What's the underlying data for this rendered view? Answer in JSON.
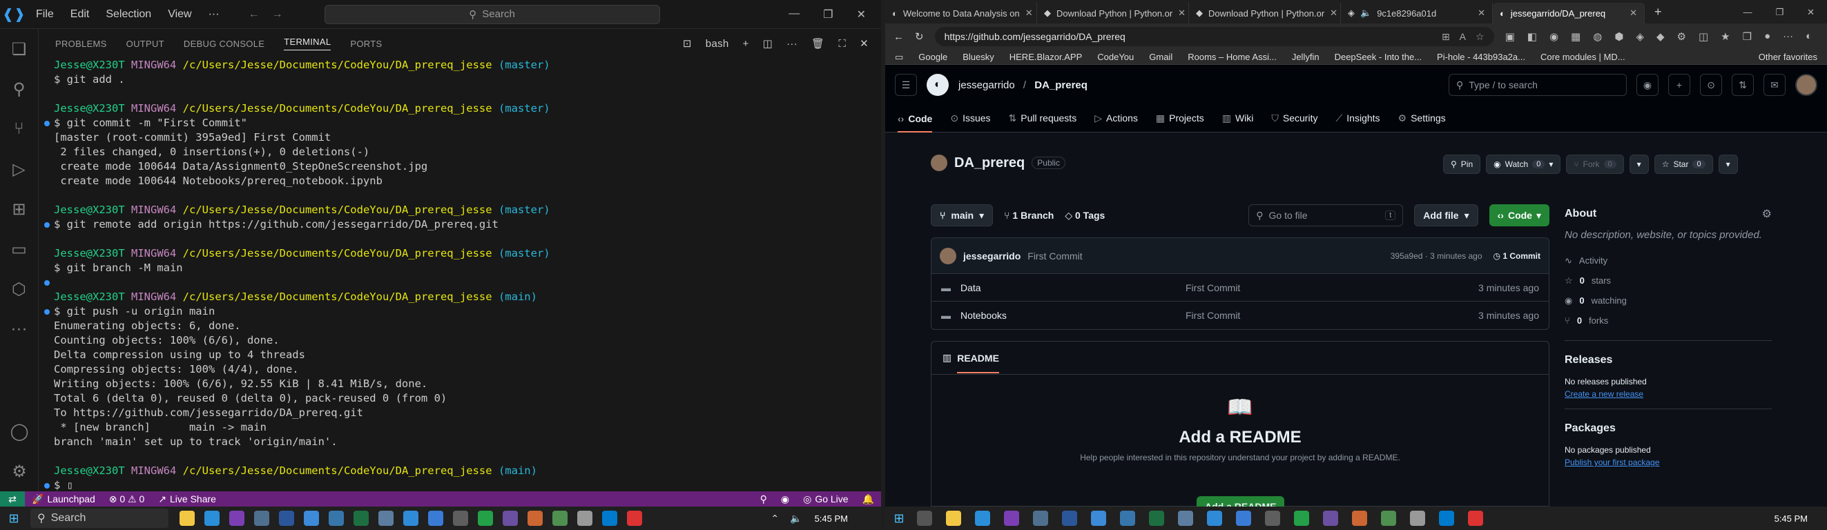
{
  "vscode": {
    "logo": "⎇",
    "menu": [
      "File",
      "Edit",
      "Selection",
      "View",
      "···"
    ],
    "search_placeholder": "Search",
    "panel_tabs": [
      "PROBLEMS",
      "OUTPUT",
      "DEBUG CONSOLE",
      "TERMINAL",
      "PORTS"
    ],
    "shell_label": "bash",
    "terminal_lines": [
      {
        "kind": "prompt",
        "user": "Jesse@X230T",
        "host": "MINGW64",
        "path": "/c/Users/Jesse/Documents/CodeYou/DA_prereq_jesse",
        "branch": "(master)"
      },
      {
        "kind": "cmd",
        "text": "$ git add ."
      },
      {
        "kind": "blank"
      },
      {
        "kind": "prompt",
        "user": "Jesse@X230T",
        "host": "MINGW64",
        "path": "/c/Users/Jesse/Documents/CodeYou/DA_prereq_jesse",
        "branch": "(master)"
      },
      {
        "kind": "cmd",
        "dot": true,
        "text": "$ git commit -m \"First Commit\""
      },
      {
        "kind": "out",
        "text": "[master (root-commit) 395a9ed] First Commit"
      },
      {
        "kind": "out",
        "text": " 2 files changed, 0 insertions(+), 0 deletions(-)"
      },
      {
        "kind": "out",
        "text": " create mode 100644 Data/Assignment0_StepOneScreenshot.jpg"
      },
      {
        "kind": "out",
        "text": " create mode 100644 Notebooks/prereq_notebook.ipynb"
      },
      {
        "kind": "blank"
      },
      {
        "kind": "prompt",
        "user": "Jesse@X230T",
        "host": "MINGW64",
        "path": "/c/Users/Jesse/Documents/CodeYou/DA_prereq_jesse",
        "branch": "(master)"
      },
      {
        "kind": "cmd",
        "dot": true,
        "text": "$ git remote add origin https://github.com/jessegarrido/DA_prereq.git"
      },
      {
        "kind": "blank"
      },
      {
        "kind": "prompt",
        "user": "Jesse@X230T",
        "host": "MINGW64",
        "path": "/c/Users/Jesse/Documents/CodeYou/DA_prereq_jesse",
        "branch": "(master)"
      },
      {
        "kind": "cmd",
        "text": "$ git branch -M main"
      },
      {
        "kind": "blank",
        "dot": true
      },
      {
        "kind": "prompt",
        "user": "Jesse@X230T",
        "host": "MINGW64",
        "path": "/c/Users/Jesse/Documents/CodeYou/DA_prereq_jesse",
        "branch": "(main)"
      },
      {
        "kind": "cmd",
        "dot": true,
        "text": "$ git push -u origin main"
      },
      {
        "kind": "out",
        "text": "Enumerating objects: 6, done."
      },
      {
        "kind": "out",
        "text": "Counting objects: 100% (6/6), done."
      },
      {
        "kind": "out",
        "text": "Delta compression using up to 4 threads"
      },
      {
        "kind": "out",
        "text": "Compressing objects: 100% (4/4), done."
      },
      {
        "kind": "out",
        "text": "Writing objects: 100% (6/6), 92.55 KiB | 8.41 MiB/s, done."
      },
      {
        "kind": "out",
        "text": "Total 6 (delta 0), reused 0 (delta 0), pack-reused 0 (from 0)"
      },
      {
        "kind": "out",
        "text": "To https://github.com/jessegarrido/DA_prereq.git"
      },
      {
        "kind": "out",
        "text": " * [new branch]      main -> main"
      },
      {
        "kind": "out",
        "text": "branch 'main' set up to track 'origin/main'."
      },
      {
        "kind": "blank"
      },
      {
        "kind": "prompt",
        "user": "Jesse@X230T",
        "host": "MINGW64",
        "path": "/c/Users/Jesse/Documents/CodeYou/DA_prereq_jesse",
        "branch": "(main)"
      },
      {
        "kind": "cmd",
        "dot": true,
        "text": "$ ▯"
      }
    ],
    "status": {
      "launchpad": "Launchpad",
      "problems": "⊗ 0 ⚠ 0",
      "live_share": "Live Share",
      "go_live": "Go Live"
    }
  },
  "browser": {
    "tabs": [
      {
        "title": "Welcome to Data Analysis on"
      },
      {
        "title": "Download Python | Python.or"
      },
      {
        "title": "Download Python | Python.or"
      },
      {
        "title": "9c1e8296a01d"
      },
      {
        "title": "jessegarrido/DA_prereq"
      }
    ],
    "url": "https://github.com/jessegarrido/DA_prereq",
    "favorites": [
      "Google",
      "Bluesky",
      "HERE.Blazor.APP",
      "CodeYou",
      "Gmail",
      "Rooms – Home Assi...",
      "Jellyfin",
      "DeepSeek - Into the...",
      "Pi-hole - 443b93a2a...",
      "Core modules | MD...",
      "Other favorites"
    ]
  },
  "github": {
    "owner": "jessegarrido",
    "repo": "DA_prereq",
    "search_placeholder": "Type / to search",
    "nav": [
      "Code",
      "Issues",
      "Pull requests",
      "Actions",
      "Projects",
      "Wiki",
      "Security",
      "Insights",
      "Settings"
    ],
    "visibility": "Public",
    "pin": "Pin",
    "watch": "Watch",
    "watch_count": "0",
    "fork": "Fork",
    "fork_count": "0",
    "star": "Star",
    "star_count": "0",
    "branch": "main",
    "branches": "1 Branch",
    "tags": "0 Tags",
    "go_to_file": "Go to file",
    "go_to_file_key": "t",
    "add_file": "Add file",
    "code_btn": "Code",
    "commit_author": "jessegarrido",
    "commit_msg": "First Commit",
    "commit_meta": "395a9ed · 3 minutes ago",
    "commit_count": "1 Commit",
    "files": [
      {
        "name": "Data",
        "msg": "First Commit",
        "age": "3 minutes ago"
      },
      {
        "name": "Notebooks",
        "msg": "First Commit",
        "age": "3 minutes ago"
      }
    ],
    "readme_tab": "README",
    "readme_title": "Add a README",
    "readme_desc": "Help people interested in this repository understand your project by adding a README.",
    "readme_btn": "Add a README",
    "about": {
      "title": "About",
      "desc": "No description, website, or topics provided.",
      "activity": "Activity",
      "stars": "0",
      "stars_label": "stars",
      "watching": "0",
      "watching_label": "watching",
      "forks": "0",
      "forks_label": "forks"
    },
    "releases": {
      "title": "Releases",
      "none": "No releases published",
      "link": "Create a new release"
    },
    "packages": {
      "title": "Packages",
      "none": "No packages published",
      "link": "Publish your first package"
    }
  },
  "taskbar": {
    "search": "Search",
    "time": "5:45 PM"
  }
}
